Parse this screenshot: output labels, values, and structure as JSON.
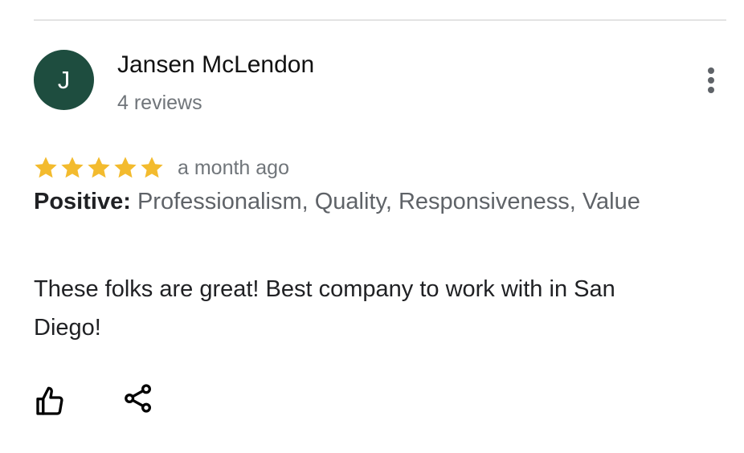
{
  "review": {
    "avatar_initial": "J",
    "author_name": "Jansen McLendon",
    "review_count": "4 reviews",
    "rating": 5,
    "rating_max": 5,
    "date": "a month ago",
    "highlights_label": "Positive:",
    "highlights_values": "Professionalism, Quality, Responsiveness, Value",
    "text": "These folks are great! Best company to work with in San Diego!"
  },
  "colors": {
    "avatar_bg": "#1e4d3f",
    "star": "#f3bb2e",
    "secondary_text": "#70757a"
  },
  "icons": {
    "more": "more-vertical-icon",
    "like": "thumbs-up-icon",
    "share": "share-icon",
    "star": "star-icon"
  }
}
